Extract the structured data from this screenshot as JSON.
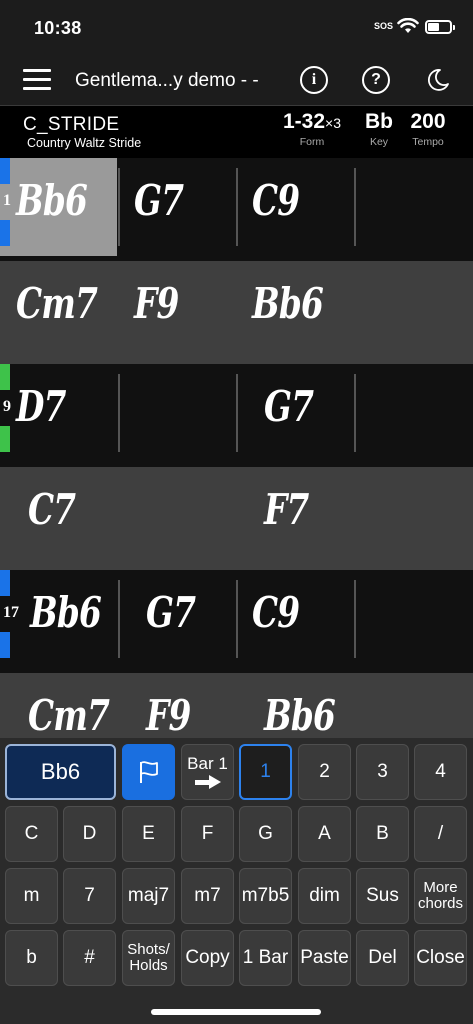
{
  "status": {
    "time": "10:38",
    "sos": "SOS"
  },
  "nav": {
    "title": "Gentlema...y demo - -",
    "info_glyph": "i",
    "help_glyph": "?"
  },
  "song": {
    "style": "C_STRIDE",
    "substyle": "Country Waltz Stride",
    "form_value": "1-32",
    "form_times": "×3",
    "form_label": "Form",
    "key_value": "Bb",
    "key_label": "Key",
    "tempo_value": "200",
    "tempo_label": "Tempo"
  },
  "rows": [
    {
      "shade": "dark",
      "marker": "blue",
      "bar_number": "1",
      "chords": [
        "Bb6",
        "G7",
        "C9",
        ""
      ]
    },
    {
      "shade": "light",
      "marker": "",
      "bar_number": "",
      "chords": [
        "Cm7",
        "F9",
        "Bb6",
        ""
      ]
    },
    {
      "shade": "dark",
      "marker": "green",
      "bar_number": "9",
      "chords": [
        "D7",
        "",
        "G7",
        ""
      ]
    },
    {
      "shade": "light",
      "marker": "",
      "bar_number": "",
      "chords": [
        "C7",
        "",
        "F7",
        ""
      ]
    },
    {
      "shade": "dark",
      "marker": "blue",
      "bar_number": "17",
      "chords": [
        "Bb6",
        "G7",
        "C9",
        ""
      ]
    },
    {
      "shade": "light",
      "marker": "",
      "bar_number": "",
      "chords": [
        "Cm7",
        "F9",
        "Bb6",
        ""
      ]
    }
  ],
  "keyboard": {
    "current_chord": "Bb6",
    "bar_label": "Bar 1",
    "beats": [
      "1",
      "2",
      "3",
      "4"
    ],
    "selected_beat": "1",
    "notes": [
      "C",
      "D",
      "E",
      "F",
      "G",
      "A",
      "B",
      "/"
    ],
    "qualities": [
      "m",
      "7",
      "maj7",
      "m7",
      "m7b5",
      "dim",
      "Sus",
      "More chords"
    ],
    "actions": [
      "b",
      "#",
      "Shots/ Holds",
      "Copy",
      "1 Bar",
      "Paste",
      "Del",
      "Close"
    ]
  },
  "colors": {
    "accent_blue": "#1a73e8",
    "marker_green": "#3ec24a",
    "selected_cell": "#9a9a9a"
  }
}
